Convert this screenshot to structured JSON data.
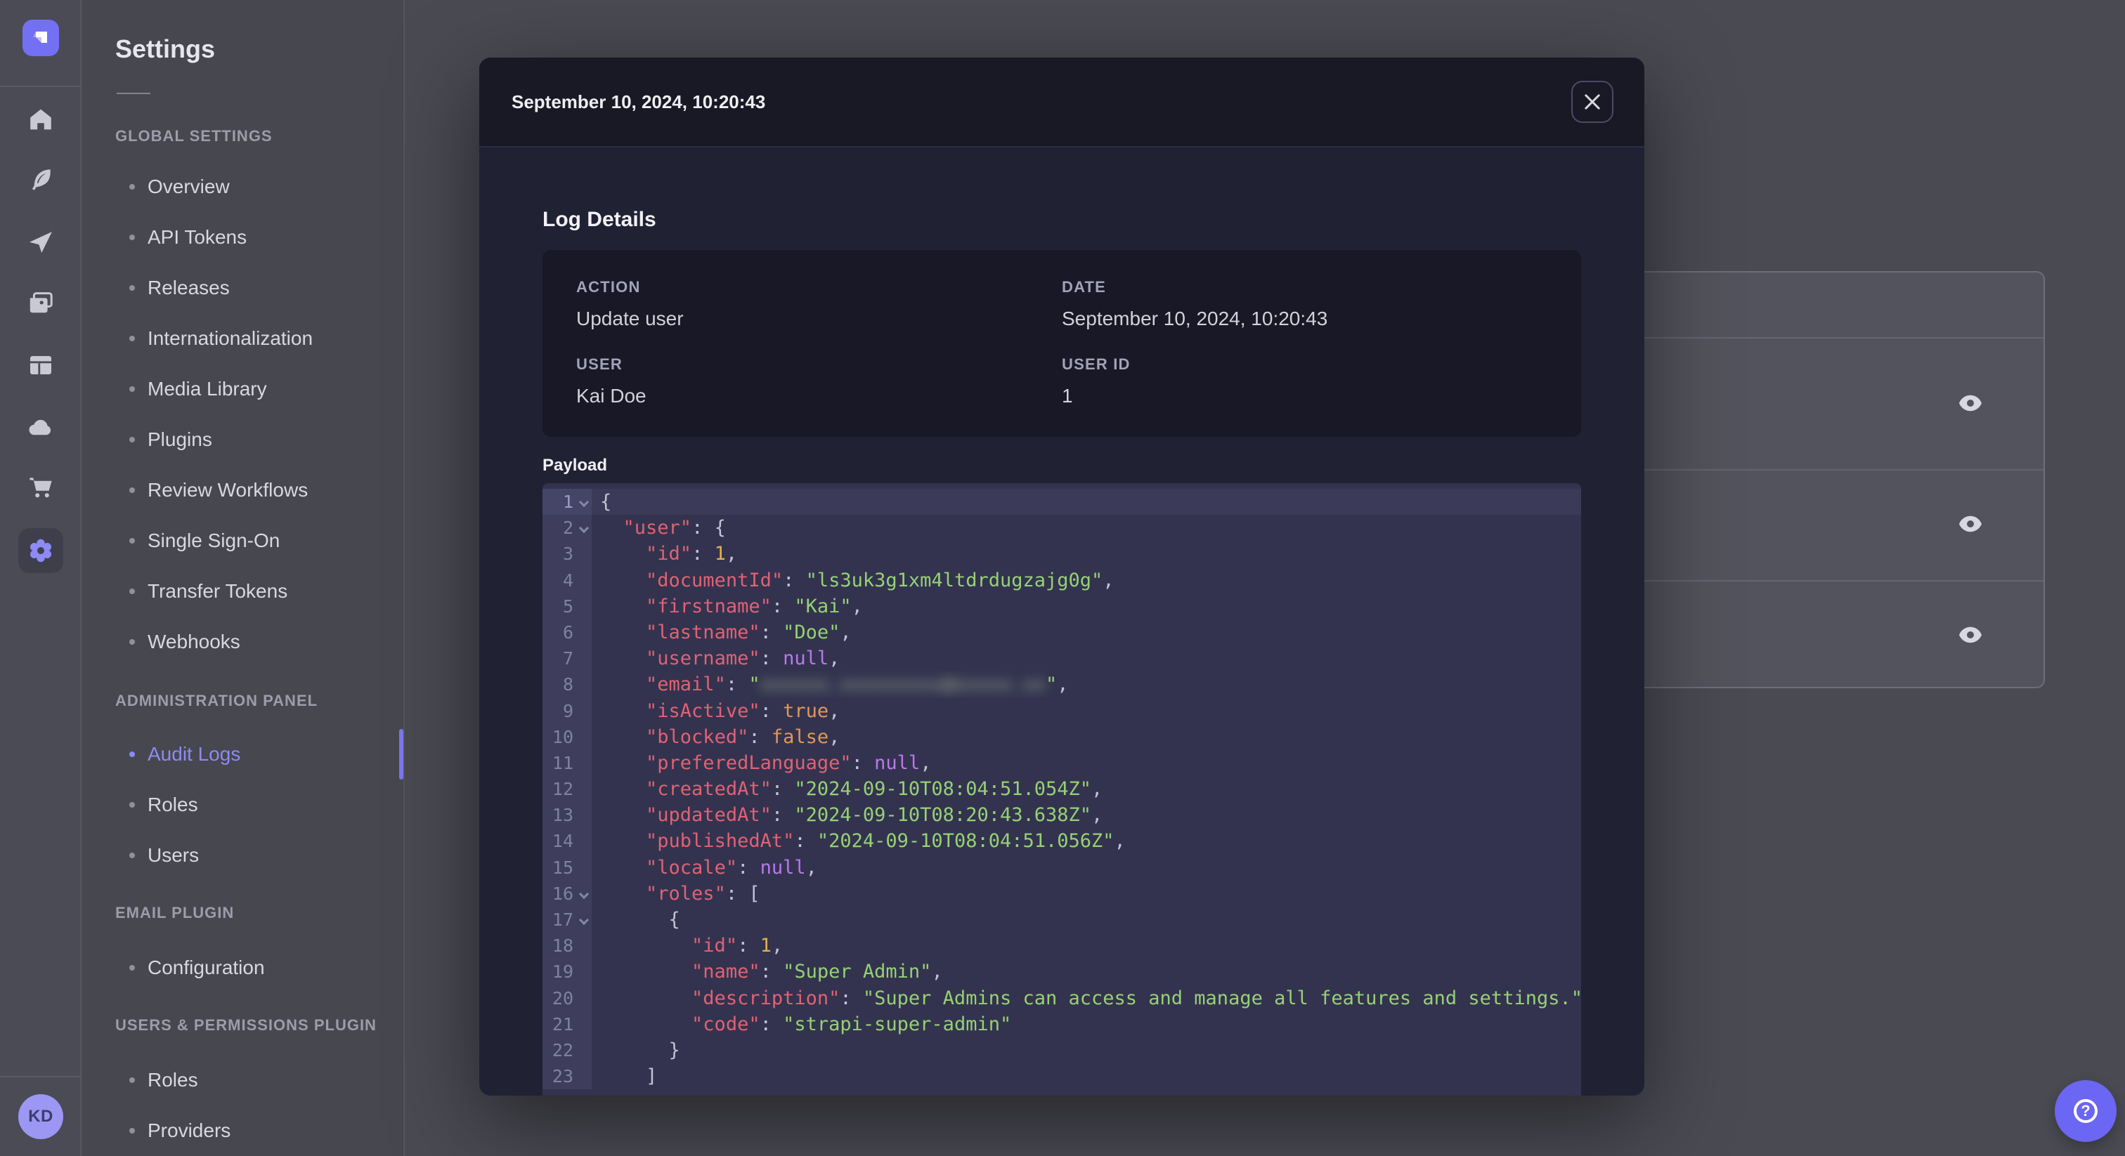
{
  "sidebar_rail": {
    "logo_icon": "strapi-logo",
    "icons": [
      "home-icon",
      "content-manager-icon",
      "release-icon",
      "media-library-icon",
      "content-type-builder-icon",
      "cloud-icon",
      "marketplace-icon",
      "settings-gear-icon"
    ],
    "active_icon": "settings-gear-icon",
    "avatar_initials": "KD"
  },
  "settings_nav": {
    "title": "Settings",
    "sections": [
      {
        "heading": "GLOBAL SETTINGS",
        "cls": "h-global",
        "items": [
          {
            "label": "Overview"
          },
          {
            "label": "API Tokens"
          },
          {
            "label": "Releases"
          },
          {
            "label": "Internationalization"
          },
          {
            "label": "Media Library"
          },
          {
            "label": "Plugins"
          },
          {
            "label": "Review Workflows"
          },
          {
            "label": "Single Sign-On"
          },
          {
            "label": "Transfer Tokens"
          },
          {
            "label": "Webhooks"
          }
        ]
      },
      {
        "heading": "ADMINISTRATION PANEL",
        "cls": "h-admin",
        "items": [
          {
            "label": "Audit Logs",
            "active": true,
            "cls": "m-audit"
          },
          {
            "label": "Roles"
          },
          {
            "label": "Users"
          }
        ]
      },
      {
        "heading": "EMAIL PLUGIN",
        "cls": "h-email",
        "items": [
          {
            "label": "Configuration",
            "cls": "m-config"
          }
        ]
      },
      {
        "heading": "USERS & PERMISSIONS PLUGIN",
        "cls": "h-users",
        "items": [
          {
            "label": "Roles",
            "cls": "m-roles2"
          },
          {
            "label": "Providers"
          }
        ]
      }
    ]
  },
  "modal": {
    "title": "September 10, 2024, 10:20:43",
    "close_icon": "close-icon",
    "section_title": "Log Details",
    "details": [
      {
        "label": "ACTION",
        "value": "Update user"
      },
      {
        "label": "DATE",
        "value": "September 10, 2024, 10:20:43"
      },
      {
        "label": "USER",
        "value": "Kai Doe"
      },
      {
        "label": "USER ID",
        "value": "1"
      }
    ],
    "payload_label": "Payload",
    "payload_lines": [
      {
        "fold": true,
        "tokens": [
          [
            "p",
            "{"
          ]
        ]
      },
      {
        "fold": true,
        "tokens": [
          [
            "p",
            "  "
          ],
          [
            "k",
            "\"user\""
          ],
          [
            "p",
            ": {"
          ]
        ]
      },
      {
        "tokens": [
          [
            "p",
            "    "
          ],
          [
            "k",
            "\"id\""
          ],
          [
            "p",
            ": "
          ],
          [
            "n",
            "1"
          ],
          [
            "p",
            ","
          ]
        ]
      },
      {
        "tokens": [
          [
            "p",
            "    "
          ],
          [
            "k",
            "\"documentId\""
          ],
          [
            "p",
            ": "
          ],
          [
            "s",
            "\"ls3uk3g1xm4ltdrdugzajg0g\""
          ],
          [
            "p",
            ","
          ]
        ]
      },
      {
        "tokens": [
          [
            "p",
            "    "
          ],
          [
            "k",
            "\"firstname\""
          ],
          [
            "p",
            ": "
          ],
          [
            "s",
            "\"Kai\""
          ],
          [
            "p",
            ","
          ]
        ]
      },
      {
        "tokens": [
          [
            "p",
            "    "
          ],
          [
            "k",
            "\"lastname\""
          ],
          [
            "p",
            ": "
          ],
          [
            "s",
            "\"Doe\""
          ],
          [
            "p",
            ","
          ]
        ]
      },
      {
        "tokens": [
          [
            "p",
            "    "
          ],
          [
            "k",
            "\"username\""
          ],
          [
            "p",
            ": "
          ],
          [
            "u",
            "null"
          ],
          [
            "p",
            ","
          ]
        ]
      },
      {
        "tokens": [
          [
            "p",
            "    "
          ],
          [
            "k",
            "\"email\""
          ],
          [
            "p",
            ": "
          ],
          [
            "s",
            "\""
          ],
          [
            "x",
            "xxxxxx.xxxxxxxxx@xxxxx.xx"
          ],
          [
            "s",
            "\""
          ],
          [
            "p",
            ","
          ]
        ]
      },
      {
        "tokens": [
          [
            "p",
            "    "
          ],
          [
            "k",
            "\"isActive\""
          ],
          [
            "p",
            ": "
          ],
          [
            "b",
            "true"
          ],
          [
            "p",
            ","
          ]
        ]
      },
      {
        "tokens": [
          [
            "p",
            "    "
          ],
          [
            "k",
            "\"blocked\""
          ],
          [
            "p",
            ": "
          ],
          [
            "b",
            "false"
          ],
          [
            "p",
            ","
          ]
        ]
      },
      {
        "tokens": [
          [
            "p",
            "    "
          ],
          [
            "k",
            "\"preferedLanguage\""
          ],
          [
            "p",
            ": "
          ],
          [
            "u",
            "null"
          ],
          [
            "p",
            ","
          ]
        ]
      },
      {
        "tokens": [
          [
            "p",
            "    "
          ],
          [
            "k",
            "\"createdAt\""
          ],
          [
            "p",
            ": "
          ],
          [
            "s",
            "\"2024-09-10T08:04:51.054Z\""
          ],
          [
            "p",
            ","
          ]
        ]
      },
      {
        "tokens": [
          [
            "p",
            "    "
          ],
          [
            "k",
            "\"updatedAt\""
          ],
          [
            "p",
            ": "
          ],
          [
            "s",
            "\"2024-09-10T08:20:43.638Z\""
          ],
          [
            "p",
            ","
          ]
        ]
      },
      {
        "tokens": [
          [
            "p",
            "    "
          ],
          [
            "k",
            "\"publishedAt\""
          ],
          [
            "p",
            ": "
          ],
          [
            "s",
            "\"2024-09-10T08:04:51.056Z\""
          ],
          [
            "p",
            ","
          ]
        ]
      },
      {
        "tokens": [
          [
            "p",
            "    "
          ],
          [
            "k",
            "\"locale\""
          ],
          [
            "p",
            ": "
          ],
          [
            "u",
            "null"
          ],
          [
            "p",
            ","
          ]
        ]
      },
      {
        "fold": true,
        "tokens": [
          [
            "p",
            "    "
          ],
          [
            "k",
            "\"roles\""
          ],
          [
            "p",
            ": ["
          ]
        ]
      },
      {
        "fold": true,
        "tokens": [
          [
            "p",
            "      {"
          ]
        ]
      },
      {
        "tokens": [
          [
            "p",
            "        "
          ],
          [
            "k",
            "\"id\""
          ],
          [
            "p",
            ": "
          ],
          [
            "n",
            "1"
          ],
          [
            "p",
            ","
          ]
        ]
      },
      {
        "tokens": [
          [
            "p",
            "        "
          ],
          [
            "k",
            "\"name\""
          ],
          [
            "p",
            ": "
          ],
          [
            "s",
            "\"Super Admin\""
          ],
          [
            "p",
            ","
          ]
        ]
      },
      {
        "tokens": [
          [
            "p",
            "        "
          ],
          [
            "k",
            "\"description\""
          ],
          [
            "p",
            ": "
          ],
          [
            "s",
            "\"Super Admins can access and manage all features and settings.\""
          ],
          [
            "p",
            ","
          ]
        ]
      },
      {
        "tokens": [
          [
            "p",
            "        "
          ],
          [
            "k",
            "\"code\""
          ],
          [
            "p",
            ": "
          ],
          [
            "s",
            "\"strapi-super-admin\""
          ]
        ]
      },
      {
        "tokens": [
          [
            "p",
            "      }"
          ]
        ]
      },
      {
        "tokens": [
          [
            "p",
            "    ]"
          ]
        ]
      }
    ]
  },
  "background_table": {
    "visible_rows": 3,
    "row_action_icon": "eye-icon"
  },
  "help_button": {
    "icon": "question-icon",
    "glyph": "?"
  },
  "colors": {
    "accent": "#7b78ee",
    "modal_header_bg": "#191926",
    "modal_body_bg": "#212134",
    "card_bg": "#181826",
    "editor_bg": "#33334f",
    "code_key": "#e06274",
    "code_string": "#96d175",
    "code_number": "#e2b14f",
    "code_null": "#b978ec"
  }
}
